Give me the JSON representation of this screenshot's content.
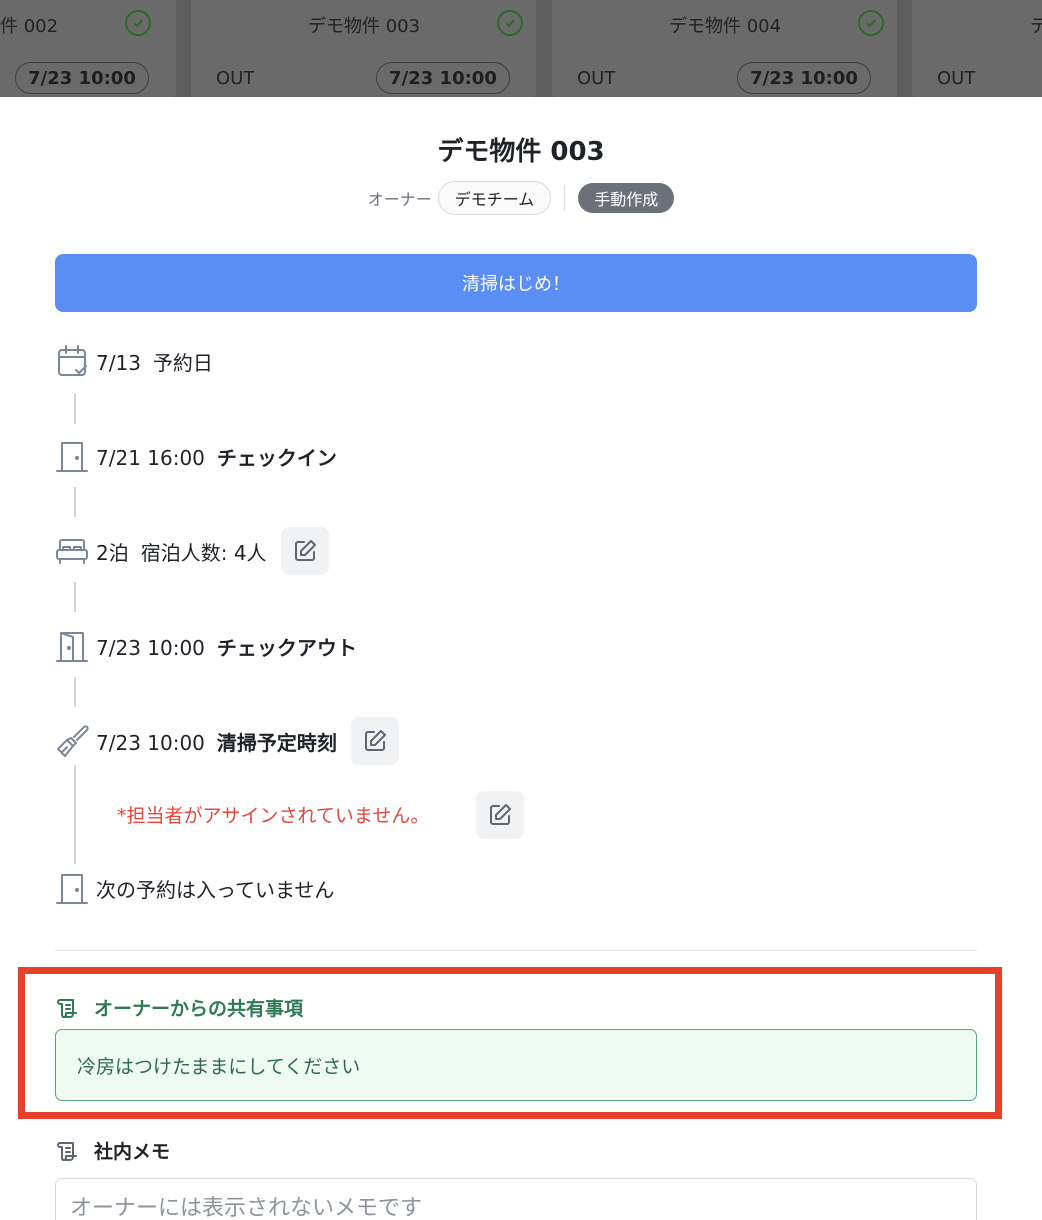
{
  "background_cards": [
    {
      "title": "件 002",
      "out_label": "",
      "date": "7/23 10:00"
    },
    {
      "title": "デモ物件 003",
      "out_label": "OUT",
      "date": "7/23 10:00"
    },
    {
      "title": "デモ物件 004",
      "out_label": "OUT",
      "date": "7/23 10:00"
    },
    {
      "title": "デ",
      "out_label": "OUT",
      "date": ""
    }
  ],
  "sheet": {
    "title": "デモ物件 003",
    "owner_label": "オーナー",
    "owner_name": "デモチーム",
    "creation_badge": "手動作成",
    "start_button": "清掃はじめ！"
  },
  "timeline": [
    {
      "icon": "calendar-check-icon",
      "value": "7/13",
      "label": "予約日",
      "editable": false
    },
    {
      "icon": "door-icon",
      "value": "7/21 16:00",
      "label": "チェックイン",
      "editable": false
    },
    {
      "icon": "bed-icon",
      "value": "2泊",
      "label": "宿泊人数: 4人",
      "editable": true
    },
    {
      "icon": "door-open-icon",
      "value": "7/23 10:00",
      "label": "チェックアウト",
      "editable": false
    },
    {
      "icon": "brush-icon",
      "value": "7/23 10:00",
      "label": "清掃予定時刻",
      "editable": true
    },
    {
      "icon": "door-icon",
      "value": "",
      "label": "次の予約は入っていません",
      "editable": false
    }
  ],
  "assignee_warning": "*担当者がアサインされていません。",
  "owner_notes": {
    "icon": "scroll-icon",
    "heading": "オーナーからの共有事項",
    "content": "冷房はつけたままにしてください",
    "accent_color": "#2f7a52"
  },
  "internal_memo": {
    "icon": "scroll-icon",
    "heading": "社内メモ",
    "placeholder": "オーナーには表示されないメモです",
    "value": ""
  },
  "colors": {
    "primary_button": "#5b8ef5",
    "warning_text": "#e5483b",
    "highlight_border": "#e4402c",
    "notes_background": "#eefaf2"
  }
}
